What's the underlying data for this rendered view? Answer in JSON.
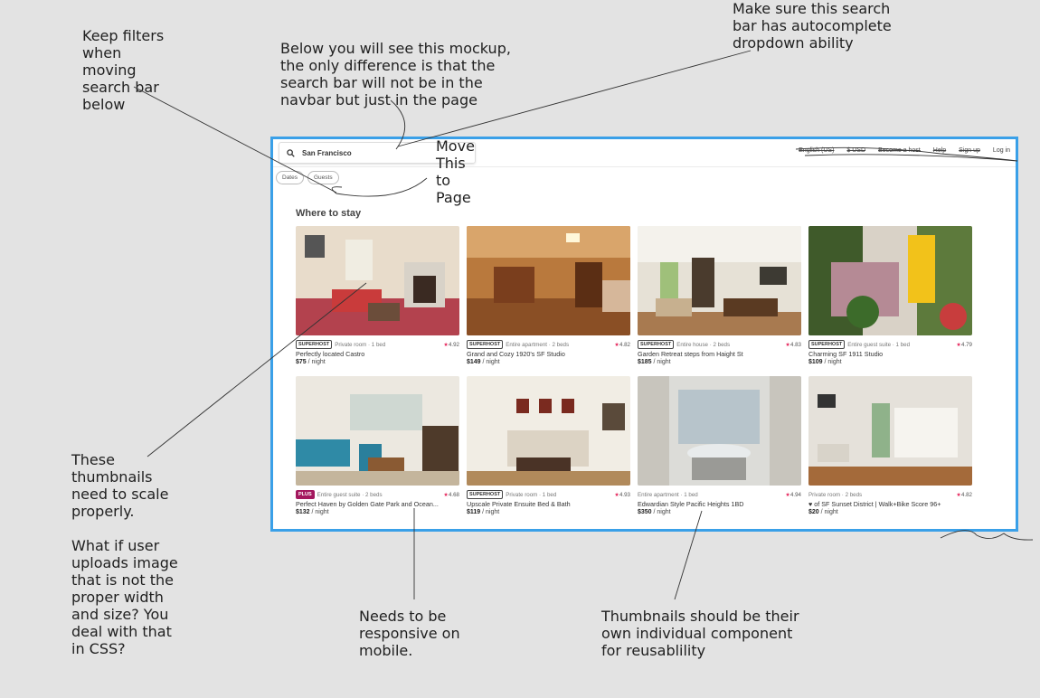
{
  "annotations": {
    "filters": "Keep filters\nwhen\nmoving\nsearch bar\nbelow",
    "mockup": "Below you will see this mockup, the only difference is that the search bar will not be in the navbar but just in the page",
    "autocomplete": "Make sure this search bar has autocomplete dropdown ability",
    "move": "Move\nThis\nto\nPage",
    "thumbnails": "These thumbnails need to scale properly.\n\nWhat if user uploads image that is not the proper width and size? You deal with that in CSS?",
    "responsive": "Needs to be responsive on mobile.",
    "component": "Thumbnails should be their own individual component for reusablility"
  },
  "navbar": {
    "search_value": "San Francisco",
    "links": [
      "English (US)",
      "$ USD",
      "Become a host",
      "Help",
      "Sign up",
      "Log in"
    ]
  },
  "filters": [
    "Dates",
    "Guests"
  ],
  "section_title": "Where to stay",
  "listings": [
    {
      "badge": "SUPERHOST",
      "type": "Private room · 1 bed",
      "rating": "4.92",
      "title": "Perfectly located Castro",
      "price": "$75",
      "unit": " / night"
    },
    {
      "badge": "SUPERHOST",
      "type": "Entire apartment · 2 beds",
      "rating": "4.82",
      "title": "Grand and Cozy 1920's SF Studio",
      "price": "$149",
      "unit": " / night"
    },
    {
      "badge": "SUPERHOST",
      "type": "Entire house · 2 beds",
      "rating": "4.83",
      "title": "Garden Retreat steps from Haight St",
      "price": "$185",
      "unit": " / night"
    },
    {
      "badge": "SUPERHOST",
      "type": "Entire guest suite · 1 bed",
      "rating": "4.79",
      "title": "Charming SF 1911 Studio",
      "price": "$109",
      "unit": " / night"
    },
    {
      "badge": "PLUS",
      "type": "Entire guest suite · 2 beds",
      "rating": "4.68",
      "title": "Perfect Haven by Golden Gate Park and Ocean...",
      "price": "$132",
      "unit": " / night"
    },
    {
      "badge": "SUPERHOST",
      "type": "Private room · 1 bed",
      "rating": "4.93",
      "title": "Upscale Private Ensuite Bed & Bath",
      "price": "$119",
      "unit": " / night"
    },
    {
      "badge": "",
      "type": "Entire apartment · 1 bed",
      "rating": "4.94",
      "title": "Edwardian Style Pacific Heights 1BD",
      "price": "$350",
      "unit": " / night"
    },
    {
      "badge": "",
      "type": "Private room · 2 beds",
      "rating": "4.82",
      "title": "♥ of SF Sunset District | Walk+Bike Score 96+",
      "price": "$20",
      "unit": " / night"
    }
  ],
  "colors": {
    "accent_border": "#3aa0e8",
    "star": "#e5245a",
    "plus_badge": "#a3185e"
  }
}
